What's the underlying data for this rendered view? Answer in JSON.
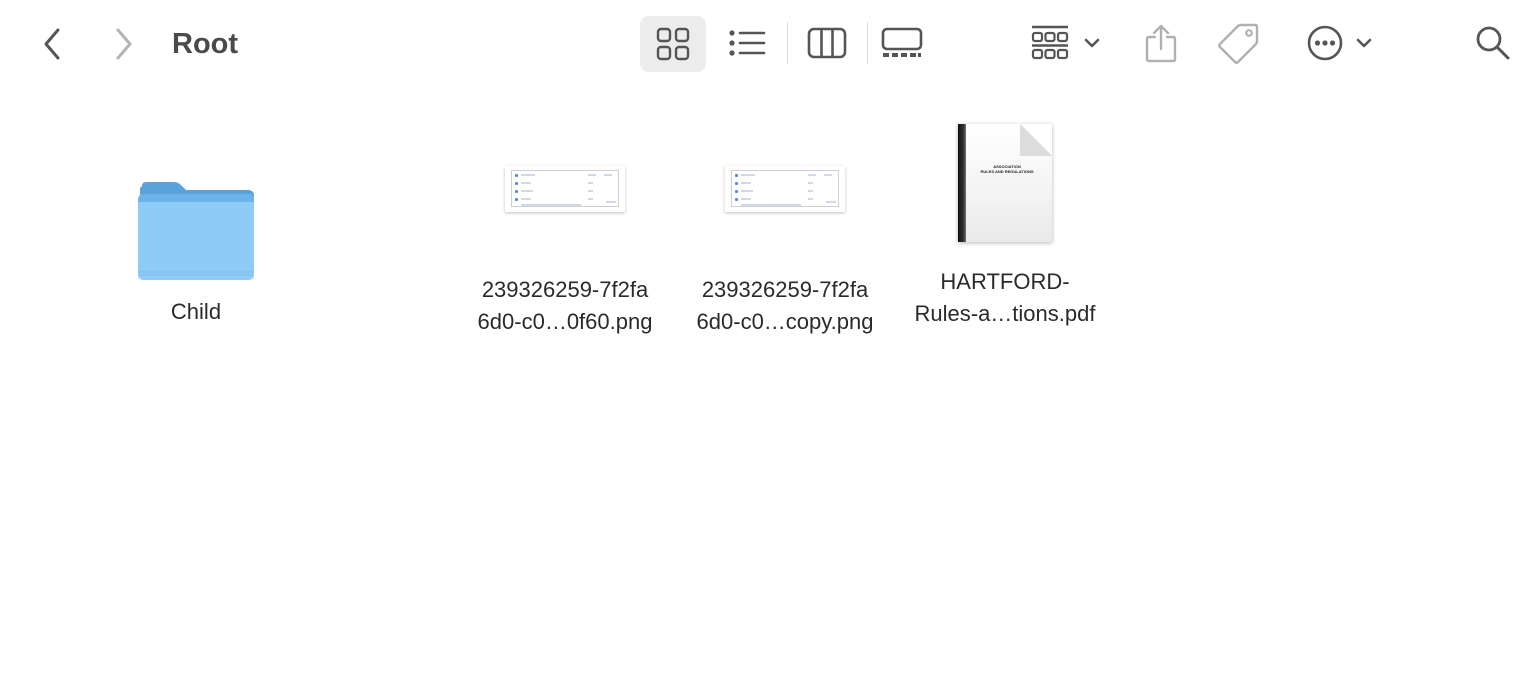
{
  "window": {
    "title": "Root"
  },
  "toolbar": {
    "icons": {
      "back": "chevron-left-icon",
      "forward": "chevron-right-icon",
      "view_icons": "grid-icon",
      "view_list": "list-icon",
      "view_columns": "columns-icon",
      "view_gallery": "gallery-icon",
      "group": "group-by-icon",
      "share": "share-icon",
      "tag": "tag-icon",
      "more": "ellipsis-circle-icon",
      "search": "search-icon"
    },
    "active_view": "icons",
    "colors": {
      "icon": "#5a5a5a",
      "icon_disabled": "#b0b0b0",
      "active_view_bg": "#ececec"
    }
  },
  "items": [
    {
      "name": "Child",
      "type": "folder"
    },
    {
      "name": "239326259-7f2fa\n6d0-c0…0f60.png",
      "type": "png"
    },
    {
      "name": "239326259-7f2fa\n6d0-c0…copy.png",
      "type": "png"
    },
    {
      "name": "HARTFORD-\nRules-a…tions.pdf",
      "type": "pdf"
    }
  ],
  "pdf_preview": {
    "line1": "ASSOCIATION",
    "line2": "RULES AND REGULATIONS"
  },
  "colors": {
    "folder_front": "#8ecbf7",
    "folder_back": "#5aa2dc"
  }
}
